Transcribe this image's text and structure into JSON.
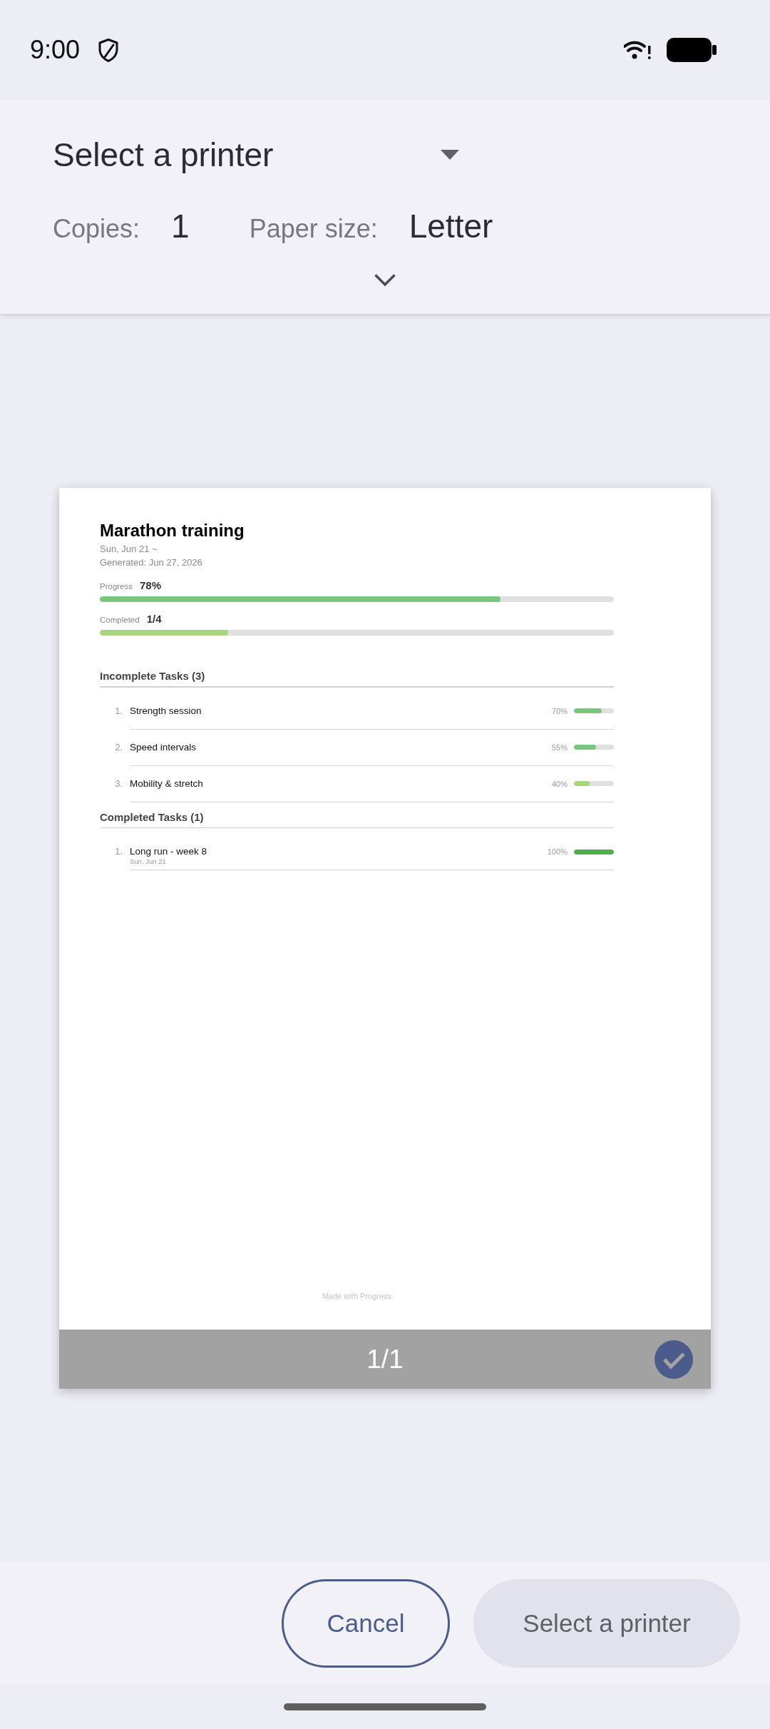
{
  "status_bar": {
    "time": "9:00"
  },
  "print_options": {
    "printer": "Select a printer",
    "copies_label": "Copies:",
    "copies": "1",
    "paper_size_label": "Paper size:",
    "paper_size": "Letter",
    "expanded": false
  },
  "preview": {
    "document": {
      "title": "Marathon training",
      "date_range": "Sun, Jun 21 ~",
      "generated": "Generated: Jun 27, 2026",
      "stats": [
        {
          "label": "Progress",
          "value": "78%",
          "level": 0.78,
          "color": "#7dc47f"
        },
        {
          "label": "Completed",
          "value": "1/4",
          "level": 0.25,
          "color": "#a7d67a"
        }
      ],
      "sections": [
        {
          "heading": "Incomplete Tasks (3)",
          "tasks": [
            {
              "number": "1.",
              "name": "Strength session",
              "percent": "70%",
              "level": 0.7,
              "color": "#7dc47f"
            },
            {
              "number": "2.",
              "name": "Speed intervals",
              "percent": "55%",
              "level": 0.55,
              "color": "#7dc47f"
            },
            {
              "number": "3.",
              "name": "Mobility & stretch",
              "percent": "40%",
              "level": 0.4,
              "color": "#a7d67a"
            }
          ]
        },
        {
          "heading": "Completed Tasks (1)",
          "tasks": [
            {
              "number": "1.",
              "name": "Long run - week 8",
              "date": "Sun, Jun 21",
              "percent": "100%",
              "level": 1,
              "color": "#4caf50"
            }
          ]
        }
      ],
      "footer": "Made with Progress"
    },
    "page_indicator": "1/1",
    "page_selected": true
  },
  "buttons": [
    {
      "label": "Cancel",
      "kind": "outlined",
      "disabled": false
    },
    {
      "label": "Select a printer",
      "kind": "filled",
      "disabled": true
    }
  ]
}
